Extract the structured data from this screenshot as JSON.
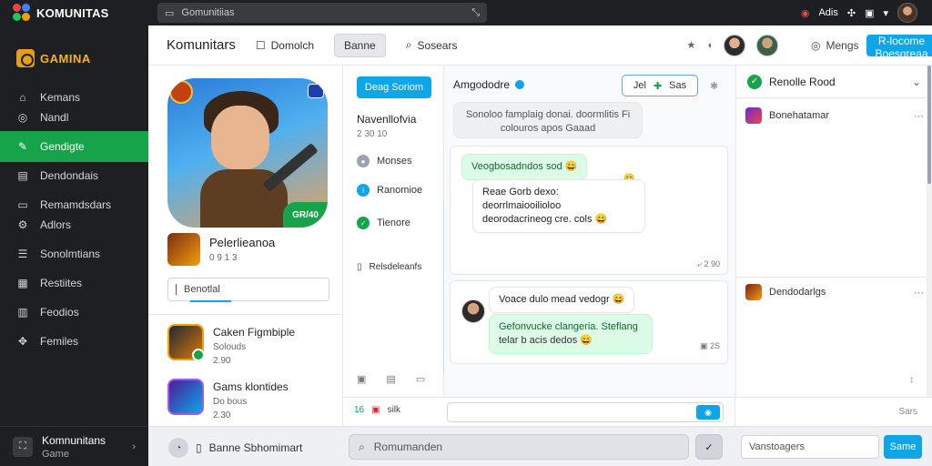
{
  "topbar": {
    "app_title": "KOMUNITAS",
    "search_placeholder": "Gomunitiias",
    "right_label": "Adis"
  },
  "sidebar": {
    "logo_text": "GAMINA",
    "items": [
      {
        "label": "Kemans",
        "icon": "home-icon"
      },
      {
        "label": "Nandl",
        "icon": "globe-icon"
      },
      {
        "label": "Gendigte",
        "icon": "controller-icon",
        "active": true
      },
      {
        "label": "Dendondais",
        "icon": "grid-icon"
      },
      {
        "label": "Remamdsdars",
        "icon": "inbox-icon"
      },
      {
        "label": "Adlors",
        "icon": "settings-icon"
      },
      {
        "label": "Sonolmtians",
        "icon": "list-icon"
      },
      {
        "label": "Restiites",
        "icon": "file-icon"
      },
      {
        "label": "Feodios",
        "icon": "chat-icon"
      },
      {
        "label": "Femiles",
        "icon": "users-icon"
      }
    ],
    "footer": {
      "title": "Komnunitans",
      "subtitle": "Game"
    }
  },
  "header": {
    "title": "Komunitars",
    "tabs": [
      "Domolch",
      "Banne",
      "Sosears"
    ],
    "selected_tab": 1,
    "merge_label": "Mengs",
    "primary_button": "R-locome Boesgreaa"
  },
  "profile": {
    "hero_badge": "GR/40",
    "name": "Pelerlieanoa",
    "stats": "0 9 1 3",
    "input_value": "Benotlal",
    "games": [
      {
        "title": "Caken Figmbiple",
        "sub1": "Solouds",
        "sub2": "2.90"
      },
      {
        "title": "Gams klontides",
        "sub1": "Do bous",
        "sub2": "2.30"
      }
    ]
  },
  "channels": {
    "button": "Deag Soriom",
    "heading": "Navenllofvia",
    "stats": "2 30  10",
    "items": [
      {
        "label": "Monses",
        "color": "#9ca3af"
      },
      {
        "label": "Ranomioe",
        "color": "#0ea5e9"
      },
      {
        "label": "Tienore",
        "color": "#16a34a"
      }
    ],
    "section": "Relsdeleanfs"
  },
  "chat": {
    "header": "Amgododre",
    "actions_label": "Jel",
    "actions_label2": "Sas",
    "system_message": "Sonoloo famplaig donai. doormlitis Fi colouros apos Gaaad",
    "card1": {
      "green_bubble": "Veogbosadndos sod 😄",
      "white_bubble_line1": "Reae Gorb dexo: deorrlmaiooilioloo",
      "white_bubble_line2": "deorodacrineog cre. cols 😄",
      "meta": "2 90"
    },
    "card2": {
      "white_bubble": "Voace dulo mead vedogr 😄",
      "green_line1": "Gefonvucke clangeria. Steflang",
      "green_line2": "telar b acis dedos 😄",
      "meta": "2S"
    }
  },
  "right_panel": {
    "header": "Renolle Rood",
    "items": [
      "Bonehatamar",
      "Dendodarlgs"
    ]
  },
  "composer": {
    "left_label1": "16",
    "left_label2": "silk",
    "right_label": "Sars"
  },
  "bottom": {
    "user_label": "Banne Sbhomimart",
    "search_placeholder": "Romumanden",
    "message_placeholder": "Vanstoagers",
    "send_label": "Same"
  }
}
